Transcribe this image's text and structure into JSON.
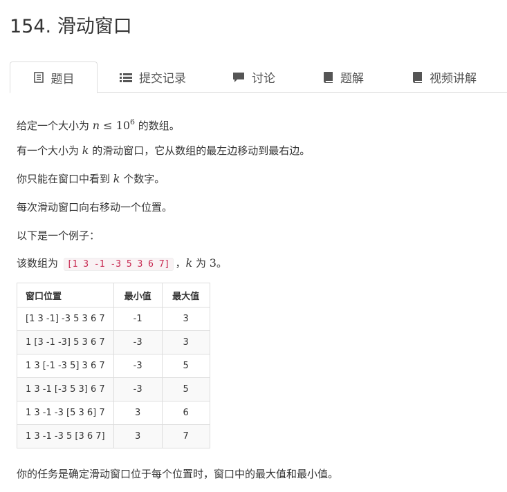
{
  "problem": {
    "title": "154. 滑动窗口"
  },
  "tabs": [
    {
      "label": "题目",
      "icon": "document-icon",
      "active": true
    },
    {
      "label": "提交记录",
      "icon": "list-icon",
      "active": false
    },
    {
      "label": "讨论",
      "icon": "comment-icon",
      "active": false
    },
    {
      "label": "题解",
      "icon": "book-icon",
      "active": false
    },
    {
      "label": "视频讲解",
      "icon": "book-icon",
      "active": false
    }
  ],
  "statement": {
    "p1_a": "给定一个大小为 ",
    "p1_math_n": "n",
    "p1_math_le": " ≤ 10",
    "p1_math_exp": "6",
    "p1_b": " 的数组。",
    "p2_a": "有一个大小为 ",
    "p2_math_k": "k",
    "p2_b": " 的滑动窗口，它从数组的最左边移动到最右边。",
    "p3_a": "你只能在窗口中看到 ",
    "p3_math_k": "k",
    "p3_b": " 个数字。",
    "p4": "每次滑动窗口向右移动一个位置。",
    "p5": "以下是一个例子：",
    "p6_a": "该数组为 ",
    "p6_code": "[1 3 -1 -3 5 3 6 7]",
    "p6_b": "，",
    "p6_math_k": "k",
    "p6_c": " 为 ",
    "p6_math_3": "3",
    "p6_d": "。",
    "p7": "你的任务是确定滑动窗口位于每个位置时，窗口中的最大值和最小值。"
  },
  "example_table": {
    "headers": [
      "窗口位置",
      "最小值",
      "最大值"
    ],
    "rows": [
      [
        "[1 3 -1] -3 5 3 6 7",
        "-1",
        "3"
      ],
      [
        "1 [3 -1 -3] 5 3 6 7",
        "-3",
        "3"
      ],
      [
        "1 3 [-1 -3 5] 3 6 7",
        "-3",
        "5"
      ],
      [
        "1 3 -1 [-3 5 3] 6 7",
        "-3",
        "5"
      ],
      [
        "1 3 -1 -3 [5 3 6] 7",
        "3",
        "6"
      ],
      [
        "1 3 -1 -3 5 [3 6 7]",
        "3",
        "7"
      ]
    ]
  },
  "colors": {
    "text": "#333333",
    "tab_text": "#555555",
    "border": "#dddddd",
    "icon": "#555555",
    "code_text": "#c7254e",
    "code_bg": "#f9f2f4"
  }
}
